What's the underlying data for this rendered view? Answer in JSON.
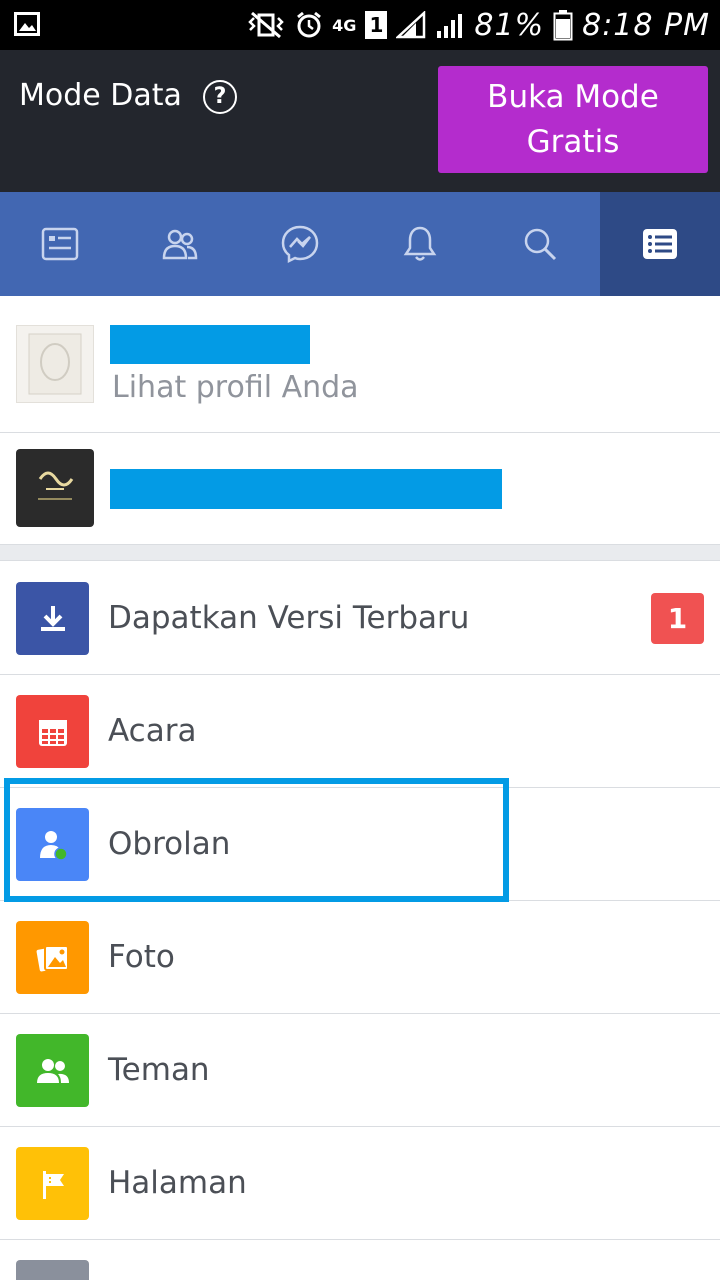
{
  "status_bar": {
    "network": "4G",
    "sim": "1",
    "battery": "81%",
    "time": "8:18 PM"
  },
  "mode_bar": {
    "title": "Mode Data",
    "help_icon": "?",
    "button_label_line1": "Buka Mode",
    "button_label_line2": "Gratis"
  },
  "nav": {
    "tabs": [
      {
        "icon": "news-feed-icon"
      },
      {
        "icon": "friends-icon"
      },
      {
        "icon": "messenger-icon"
      },
      {
        "icon": "notifications-icon"
      },
      {
        "icon": "search-icon"
      },
      {
        "icon": "menu-icon",
        "active": true
      }
    ]
  },
  "profile": {
    "subtitle": "Lihat profil Anda"
  },
  "menu": {
    "items": [
      {
        "label": "Dapatkan Versi Terbaru",
        "icon": "download-icon",
        "color": "#3b55a6",
        "badge": "1"
      },
      {
        "label": "Acara",
        "icon": "calendar-icon",
        "color": "#f0433c"
      },
      {
        "label": "Obrolan",
        "icon": "chat-person-icon",
        "color": "#4a86f7",
        "highlighted": true
      },
      {
        "label": "Foto",
        "icon": "photo-icon",
        "color": "#ff9800"
      },
      {
        "label": "Teman",
        "icon": "friends-icon",
        "color": "#42b72a"
      },
      {
        "label": "Halaman",
        "icon": "flag-icon",
        "color": "#ffc107"
      }
    ]
  },
  "colors": {
    "nav_bg": "#4267b2",
    "nav_active": "#2e4a86",
    "button_purple": "#b42ccd",
    "badge_red": "#f05252",
    "highlight_blue": "#039be5"
  }
}
